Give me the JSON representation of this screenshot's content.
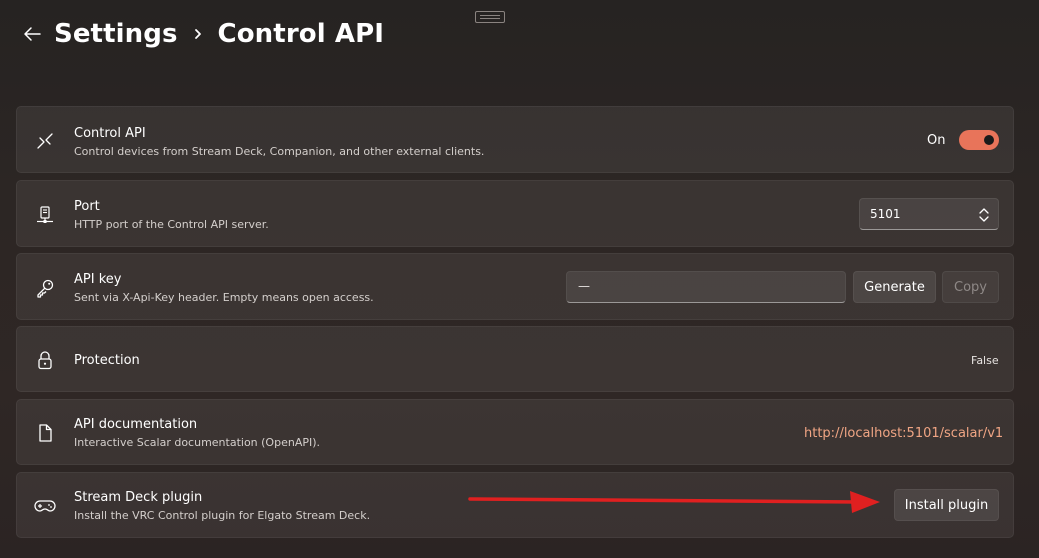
{
  "breadcrumb": {
    "parent": "Settings",
    "current": "Control API"
  },
  "colors": {
    "accent": "#e8745a",
    "link": "#f0a584",
    "annotation_arrow": "#e02020"
  },
  "cards": {
    "control_api": {
      "icon": "control-api-icon",
      "title": "Control API",
      "description": "Control devices from Stream Deck, Companion, and other external clients.",
      "toggle_label": "On",
      "toggle_on": true
    },
    "port": {
      "icon": "server-icon",
      "title": "Port",
      "description": "HTTP port of the Control API server.",
      "value": "5101"
    },
    "api_key": {
      "icon": "key-icon",
      "title": "API key",
      "description": "Sent via X-Api-Key header. Empty means open access.",
      "input_value": "—",
      "generate_label": "Generate",
      "copy_label": "Copy"
    },
    "protection": {
      "icon": "lock-icon",
      "title": "Protection",
      "value": "False"
    },
    "api_docs": {
      "icon": "document-icon",
      "title": "API documentation",
      "description": "Interactive Scalar documentation (OpenAPI).",
      "link": "http://localhost:5101/scalar/v1"
    },
    "stream_deck": {
      "icon": "gamepad-icon",
      "title": "Stream Deck plugin",
      "description": "Install the VRC Control plugin for Elgato Stream Deck.",
      "button_label": "Install plugin"
    }
  }
}
